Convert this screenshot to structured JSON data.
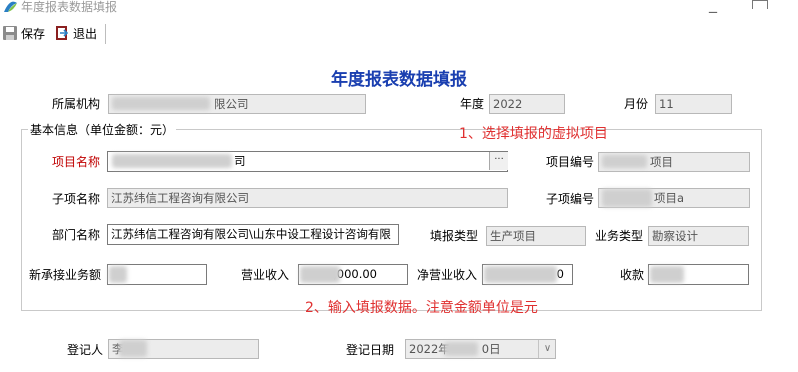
{
  "window": {
    "title": "年度报表数据填报"
  },
  "toolbar": {
    "save_label": "保存",
    "exit_label": "退出"
  },
  "form": {
    "heading": "年度报表数据填报",
    "org_label": "所属机构",
    "org_value": "限公司",
    "year_label": "年度",
    "year_value": "2022",
    "month_label": "月份",
    "month_value": "11",
    "group_label": "基本信息（单位金额：元）",
    "project_name_label": "项目名称",
    "project_name_value": "司",
    "project_code_label": "项目编号",
    "project_code_value": "项目",
    "sub_name_label": "子项名称",
    "sub_name_value": "江苏纬信工程咨询有限公司",
    "sub_code_label": "子项编号",
    "sub_code_value": "项目a",
    "dept_label": "部门名称",
    "dept_value": "江苏纬信工程咨询有限公司\\山东中设工程设计咨询有限",
    "fill_type_label": "填报类型",
    "fill_type_value": "生产项目",
    "biz_type_label": "业务类型",
    "biz_type_value": "勘察设计",
    "new_contract_label": "新承接业务额",
    "new_contract_value": "",
    "revenue_label": "营业收入",
    "revenue_value": ",000.00",
    "net_revenue_label": "净营业收入",
    "net_revenue_value": "0",
    "receipts_label": "收款",
    "receipts_value": "",
    "registrar_label": "登记人",
    "registrar_value": "李",
    "reg_date_label": "登记日期",
    "reg_date_value": "2022年",
    "reg_date_suffix": "0日"
  },
  "annotations": {
    "note1": "1、选择填报的虚拟项目",
    "note2": "2、输入填报数据。注意金额单位是元"
  },
  "colors": {
    "heading": "#1a3fb0",
    "required_label": "#c00000",
    "annotation": "#e03030"
  }
}
